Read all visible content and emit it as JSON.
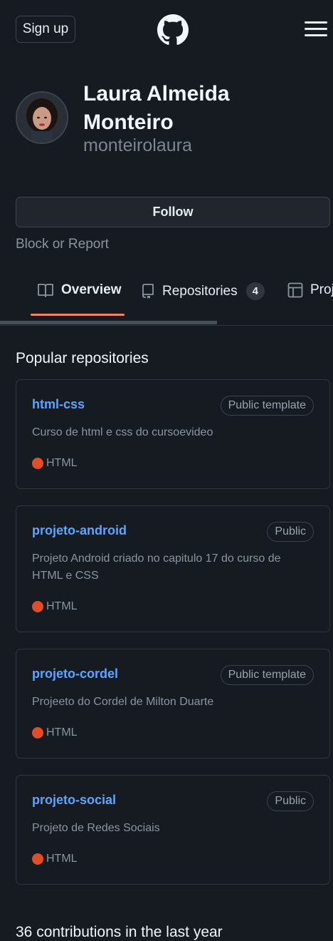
{
  "header": {
    "signup_label": "Sign up",
    "logo_icon": "github-mark-icon",
    "menu_icon": "hamburger-menu-icon"
  },
  "profile": {
    "name": "Laura Almeida Monteiro",
    "username": "monteirolaura",
    "follow_label": "Follow",
    "block_label": "Block or Report"
  },
  "tabs": [
    {
      "label": "Overview",
      "icon": "book-icon",
      "active": true
    },
    {
      "label": "Repositories",
      "icon": "repo-icon",
      "count": "4"
    },
    {
      "label": "Projects",
      "icon": "table-icon"
    }
  ],
  "section": {
    "popular_title": "Popular repositories",
    "contributions": "36 contributions in the last year"
  },
  "repos": [
    {
      "name": "html-css",
      "visibility": "Public template",
      "description": "Curso de html e css do cursoevideo",
      "language": "HTML"
    },
    {
      "name": "projeto-android",
      "visibility": "Public",
      "description": "Projeto Android criado no capitulo 17 do curso de HTML e CSS",
      "language": "HTML"
    },
    {
      "name": "projeto-cordel",
      "visibility": "Public template",
      "description": "Projeeto do Cordel de Milton Duarte",
      "language": "HTML"
    },
    {
      "name": "projeto-social",
      "visibility": "Public",
      "description": "Projeto de Redes Sociais",
      "language": "HTML"
    }
  ],
  "colors": {
    "background": "#161b22",
    "link": "#58a6ff",
    "tab_active": "#f78166",
    "html_language": "#e34c26"
  }
}
